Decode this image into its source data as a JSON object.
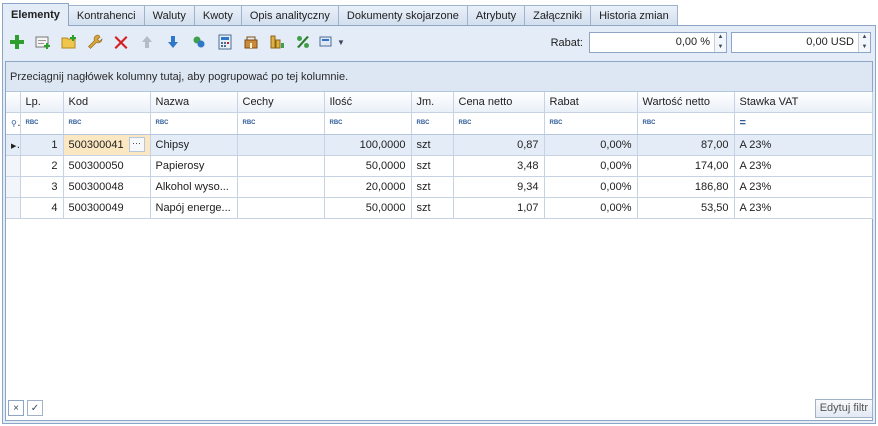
{
  "tabs": [
    {
      "label": "Elementy",
      "active": true
    },
    {
      "label": "Kontrahenci",
      "active": false
    },
    {
      "label": "Waluty",
      "active": false
    },
    {
      "label": "Kwoty",
      "active": false
    },
    {
      "label": "Opis analityczny",
      "active": false
    },
    {
      "label": "Dokumenty skojarzone",
      "active": false
    },
    {
      "label": "Atrybuty",
      "active": false
    },
    {
      "label": "Załączniki",
      "active": false
    },
    {
      "label": "Historia zmian",
      "active": false
    }
  ],
  "toolbar": {
    "icons": [
      "add-icon",
      "add-item-icon",
      "add-from-list-icon",
      "edit-icon",
      "delete-icon",
      "move-up-icon",
      "move-down-icon",
      "refresh-icon",
      "calculator-icon",
      "shop-icon",
      "stock-icon",
      "percent-icon",
      "more-icon"
    ],
    "rabat_label": "Rabat:",
    "rabat_percent": "0,00 %",
    "rabat_amount": "0,00 USD"
  },
  "grid": {
    "group_hint": "Przeciągnij nagłówek kolumny tutaj, aby pogrupować po tej kolumnie.",
    "columns": [
      "Lp.",
      "Kod",
      "Nazwa",
      "Cechy",
      "Ilość",
      "Jm.",
      "Cena netto",
      "Rabat",
      "Wartość netto",
      "Stawka VAT"
    ],
    "filter_symbol": "RBC",
    "vat_filter_symbol": "=",
    "rows": [
      {
        "lp": "1",
        "kod": "500300041",
        "nazwa": "Chipsy",
        "cechy": "",
        "ilosc": "100,0000",
        "jm": "szt",
        "cena": "0,87",
        "rabat": "0,00%",
        "wartosc": "87,00",
        "vat": "A 23%",
        "selected": true
      },
      {
        "lp": "2",
        "kod": "500300050",
        "nazwa": "Papierosy",
        "cechy": "",
        "ilosc": "50,0000",
        "jm": "szt",
        "cena": "3,48",
        "rabat": "0,00%",
        "wartosc": "174,00",
        "vat": "A 23%",
        "selected": false
      },
      {
        "lp": "3",
        "kod": "500300048",
        "nazwa": "Alkohol wyso...",
        "cechy": "",
        "ilosc": "20,0000",
        "jm": "szt",
        "cena": "9,34",
        "rabat": "0,00%",
        "wartosc": "186,80",
        "vat": "A 23%",
        "selected": false
      },
      {
        "lp": "4",
        "kod": "500300049",
        "nazwa": "Napój energe...",
        "cechy": "",
        "ilosc": "50,0000",
        "jm": "szt",
        "cena": "1,07",
        "rabat": "0,00%",
        "wartosc": "53,50",
        "vat": "A 23%",
        "selected": false
      }
    ],
    "ellipsis": "···"
  },
  "footer": {
    "edit_filter_label": "Edytuj filtr",
    "close_filter_symbol": "×",
    "check_symbol": "✓"
  },
  "colors": {
    "panel_bg": "#e4ecf7",
    "border": "#8ea6c6",
    "selected_cell": "#fbe7c2",
    "add_green": "#2e9e2e",
    "delete_red": "#d42020"
  }
}
